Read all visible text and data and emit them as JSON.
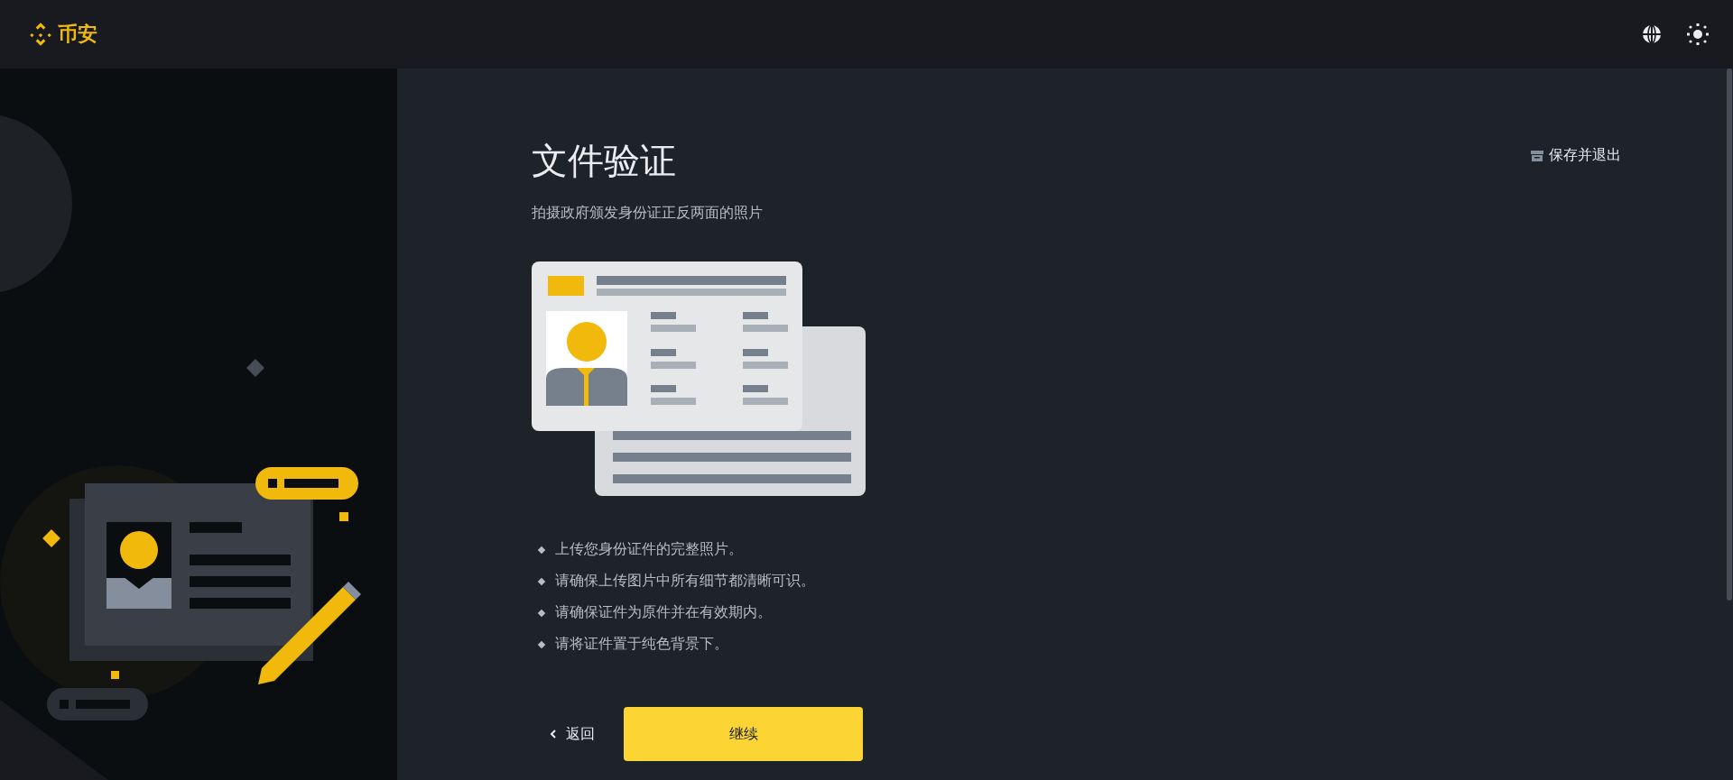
{
  "header": {
    "logo_text": "币安"
  },
  "page": {
    "title": "文件验证",
    "subtitle": "拍摄政府颁发身份证正反两面的照片",
    "save_exit": "保存并退出",
    "instructions": [
      "上传您身份证件的完整照片。",
      "请确保上传图片中所有细节都清晰可识。",
      "请确保证件为原件并在有效期内。",
      "请将证件置于纯色背景下。"
    ],
    "back": "返回",
    "continue": "继续"
  }
}
